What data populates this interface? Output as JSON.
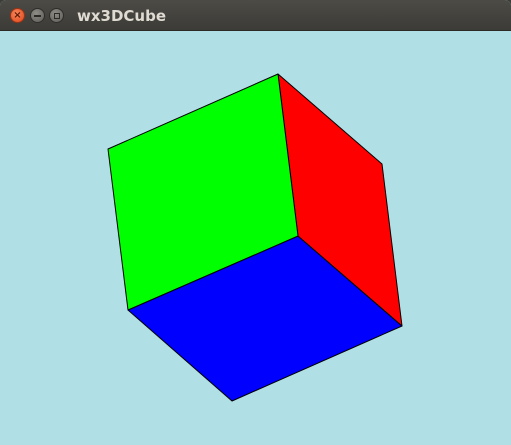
{
  "window": {
    "title": "wx3DCube"
  },
  "titlebar_buttons": {
    "close_icon": "close-icon",
    "minimize_icon": "minimize-icon",
    "maximize_icon": "maximize-icon"
  },
  "canvas": {
    "background": "#b0dfe6",
    "cube_faces": [
      {
        "name": "top-face",
        "color": "#00ff00"
      },
      {
        "name": "right-face",
        "color": "#ff0000"
      },
      {
        "name": "bottom-face",
        "color": "#0000ff"
      }
    ],
    "edge_color": "#000000"
  }
}
